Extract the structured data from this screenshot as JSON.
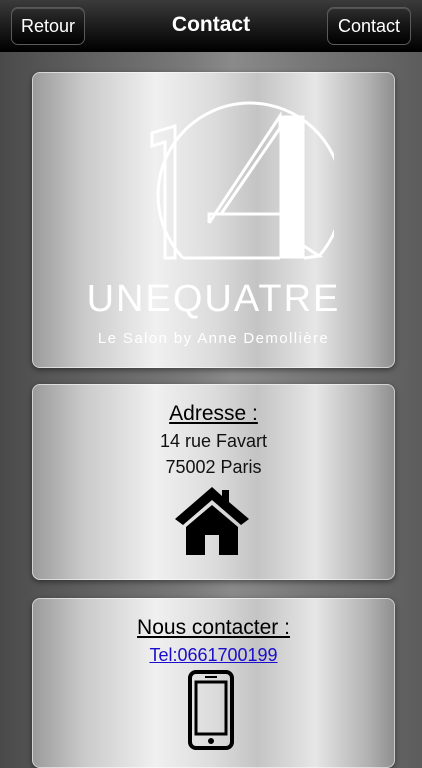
{
  "navbar": {
    "title": "Contact",
    "back_label": "Retour",
    "contact_label": "Contact"
  },
  "logo": {
    "brand_name": "UNEQUATRE",
    "tagline": "Le Salon by Anne Demollière",
    "icon": "salon-14-logo"
  },
  "address": {
    "heading": "Adresse :",
    "street": "14 rue Favart",
    "city": "75002 Paris",
    "icon": "home-icon"
  },
  "contact": {
    "heading": "Nous contacter :",
    "phone_link": "Tel:0661700199",
    "icon": "mobile-phone-icon",
    "link_color": "#1a0dcc"
  }
}
